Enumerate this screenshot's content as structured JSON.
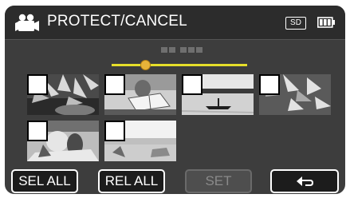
{
  "header": {
    "title": "PROTECT/CANCEL",
    "camera_icon": "video-camera-icon",
    "storage_badge": "SD",
    "battery_icon": "battery-full-icon"
  },
  "page_indicator": {
    "icon": "page-blocks-icon"
  },
  "slider": {
    "position_fraction": 0.25,
    "track_color": "#e6df2a",
    "knob_color": "#e8b33a"
  },
  "thumbnails": [
    {
      "name": "thumbnail-1",
      "scene": "palm-leaves-on-dark-rock",
      "checked": false
    },
    {
      "name": "thumbnail-2",
      "scene": "person-reading-book",
      "checked": false
    },
    {
      "name": "thumbnail-3",
      "scene": "boat-on-lake",
      "checked": false
    },
    {
      "name": "thumbnail-4",
      "scene": "flowers-dark-foliage",
      "checked": false
    },
    {
      "name": "thumbnail-5",
      "scene": "people-on-beach",
      "checked": false
    },
    {
      "name": "thumbnail-6",
      "scene": "beach-bright-sky",
      "checked": false
    }
  ],
  "buttons": {
    "sel_all": "SEL ALL",
    "rel_all": "REL ALL",
    "set": "SET",
    "back_icon": "return-arrow-icon"
  },
  "colors": {
    "screen_bg": "#3d3d3d",
    "header_bg": "#2c2c2c",
    "button_bg": "#1c1c1c",
    "disabled_button_bg": "#4e4e4e"
  }
}
